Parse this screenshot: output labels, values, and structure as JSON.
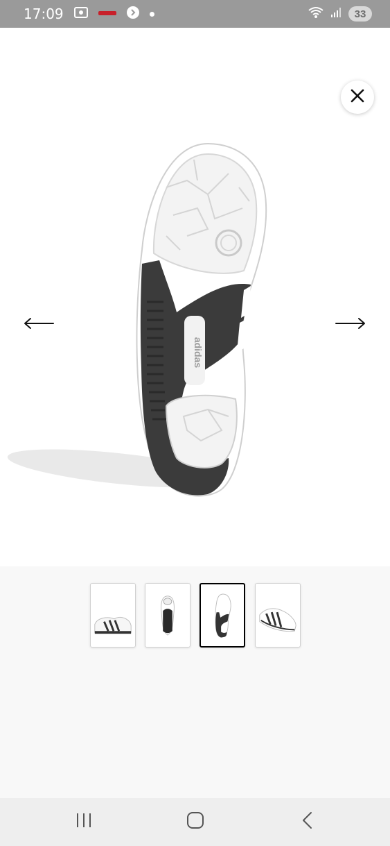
{
  "status_bar": {
    "time": "17:09",
    "battery_level": "33",
    "icons": [
      "screen-record-icon",
      "notification-app-icon",
      "shazam-icon",
      "dot-icon",
      "wifi-icon",
      "signal-icon",
      "battery-icon"
    ]
  },
  "viewer": {
    "close_icon": "close-icon",
    "prev_icon": "arrow-left-icon",
    "next_icon": "arrow-right-icon",
    "current_image": "shoe-sole-bottom-view",
    "sole_logo_text": "adidas"
  },
  "thumbnails": {
    "selected_index": 2,
    "items": [
      {
        "view": "side-view"
      },
      {
        "view": "top-view"
      },
      {
        "view": "sole-view"
      },
      {
        "view": "angle-view"
      }
    ]
  },
  "nav_bar": {
    "icons": [
      "recent-apps-icon",
      "home-icon",
      "back-icon"
    ]
  },
  "colors": {
    "status_bar_bg": "#9a9a9a",
    "thumb_area_bg": "#f8f8f8",
    "nav_bar_bg": "#eeeeee",
    "sole_dark": "#3b3b3b"
  }
}
